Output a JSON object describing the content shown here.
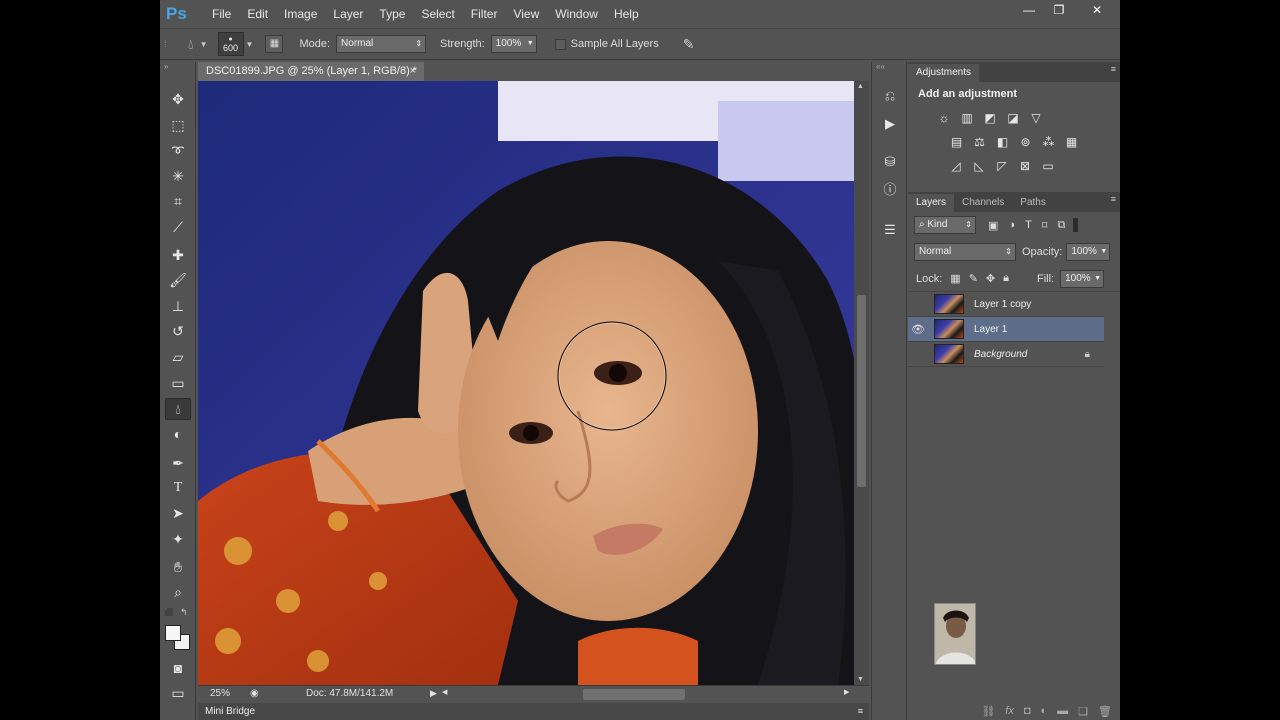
{
  "app": {
    "logo": "Ps",
    "menu": [
      "File",
      "Edit",
      "Image",
      "Layer",
      "Type",
      "Select",
      "Filter",
      "View",
      "Window",
      "Help"
    ],
    "window_controls": [
      "—",
      "❐",
      "✕"
    ]
  },
  "options_bar": {
    "brush_size": "600",
    "mode_label": "Mode:",
    "mode_value": "Normal",
    "strength_label": "Strength:",
    "strength_value": "100%",
    "sample_all_layers": "Sample All Layers"
  },
  "document": {
    "tab_title": "DSC01899.JPG @ 25% (Layer 1, RGB/8) *",
    "tab_close": "×",
    "zoom": "25%",
    "doc_info": "Doc: 47.8M/141.2M"
  },
  "mini_bridge": {
    "label": "Mini Bridge"
  },
  "adjustments": {
    "tab": "Adjustments",
    "title": "Add an adjustment"
  },
  "layers_panel": {
    "tabs": [
      "Layers",
      "Channels",
      "Paths"
    ],
    "kind_label": "Kind",
    "blend_mode": "Normal",
    "opacity_label": "Opacity:",
    "opacity_value": "100%",
    "lock_label": "Lock:",
    "fill_label": "Fill:",
    "fill_value": "100%",
    "layers": [
      {
        "name": "Layer 1 copy",
        "visible": false,
        "selected": false
      },
      {
        "name": "Layer 1",
        "visible": true,
        "selected": true
      },
      {
        "name": "Background",
        "visible": false,
        "selected": false,
        "locked": true
      }
    ]
  },
  "colors": {
    "ui_bg": "#535353",
    "panel_dark": "#424242",
    "selection": "#5e6e8a",
    "ps_blue": "#4aa3e6"
  }
}
